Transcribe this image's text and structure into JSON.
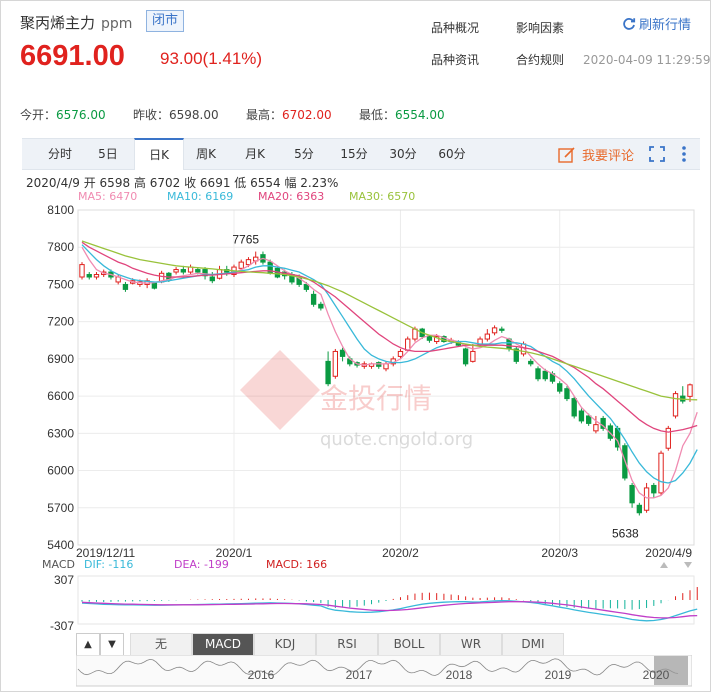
{
  "header": {
    "title": "聚丙烯主力",
    "unit": "ppm",
    "status": "闭市",
    "price": "6691.00",
    "change": "93.00(1.41%)",
    "links": [
      "品种概况",
      "影响因素",
      "品种资讯",
      "合约规则"
    ],
    "refresh": "刷新行情",
    "datetime": "2020-04-09 11:29:59"
  },
  "stats": [
    {
      "label": "今开：",
      "value": "6576.00",
      "color": "g"
    },
    {
      "label": "昨收：",
      "value": "6598.00",
      "color": ""
    },
    {
      "label": "最高：",
      "value": "6702.00",
      "color": "r"
    },
    {
      "label": "最低：",
      "value": "6554.00",
      "color": "g"
    }
  ],
  "tabs": [
    "分时",
    "5日",
    "日K",
    "周K",
    "月K",
    "5分",
    "15分",
    "30分",
    "60分"
  ],
  "active_tab": "日K",
  "comment": "我要评论",
  "bar_info": {
    "date": "2020/4/9",
    "open": "开 6598",
    "high": "高 6702",
    "close": "收 6691",
    "low": "低 6554",
    "amp": "幅 2.23%"
  },
  "ma_legend": [
    {
      "label": "MA5: 6470",
      "color": "#f08bb1"
    },
    {
      "label": "MA10: 6169",
      "color": "#39b9d9"
    },
    {
      "label": "MA20: 6363",
      "color": "#e0457d"
    },
    {
      "label": "MA30: 6570",
      "color": "#99c23b"
    }
  ],
  "macd_legend": [
    {
      "label": "MACD",
      "color": "#555555"
    },
    {
      "label": "DIF: -116",
      "color": "#39b9d9"
    },
    {
      "label": "DEA: -199",
      "color": "#c03ec8"
    },
    {
      "label": "MACD: 166",
      "color": "#d02020"
    }
  ],
  "macd_axis": {
    "top": "307",
    "bottom": "-307"
  },
  "indicator_tabs": [
    "无",
    "MACD",
    "KDJ",
    "RSI",
    "BOLL",
    "WR",
    "DMI"
  ],
  "active_indicator": "MACD",
  "nav_years": [
    "2016",
    "2017",
    "2018",
    "2019",
    "2020"
  ],
  "watermark": {
    "text": "金投行情",
    "url": "quote.cngold.org"
  },
  "chart_data": {
    "type": "candlestick",
    "y_ticks": [
      8100,
      7800,
      7500,
      7200,
      6900,
      6600,
      6300,
      6000,
      5700,
      5400
    ],
    "ylim": [
      5400,
      8100
    ],
    "x_labels": [
      "2019/12/11",
      "2020/1",
      "2020/2",
      "2020/3",
      "2020/4/9"
    ],
    "annotations": [
      {
        "label": "7765",
        "value": 7765
      },
      {
        "label": "5638",
        "value": 5638
      }
    ],
    "candles": [
      {
        "o": 7560,
        "c": 7660,
        "h": 7680,
        "l": 7540
      },
      {
        "o": 7580,
        "c": 7560,
        "h": 7600,
        "l": 7540
      },
      {
        "o": 7560,
        "c": 7580,
        "h": 7600,
        "l": 7540
      },
      {
        "o": 7580,
        "c": 7600,
        "h": 7620,
        "l": 7560
      },
      {
        "o": 7600,
        "c": 7560,
        "h": 7620,
        "l": 7540
      },
      {
        "o": 7520,
        "c": 7560,
        "h": 7580,
        "l": 7500
      },
      {
        "o": 7500,
        "c": 7460,
        "h": 7520,
        "l": 7440
      },
      {
        "o": 7510,
        "c": 7530,
        "h": 7550,
        "l": 7500
      },
      {
        "o": 7500,
        "c": 7520,
        "h": 7540,
        "l": 7480
      },
      {
        "o": 7500,
        "c": 7530,
        "h": 7550,
        "l": 7470
      },
      {
        "o": 7510,
        "c": 7470,
        "h": 7520,
        "l": 7460
      },
      {
        "o": 7520,
        "c": 7590,
        "h": 7610,
        "l": 7510
      },
      {
        "o": 7590,
        "c": 7540,
        "h": 7600,
        "l": 7520
      },
      {
        "o": 7600,
        "c": 7620,
        "h": 7640,
        "l": 7580
      },
      {
        "o": 7620,
        "c": 7600,
        "h": 7650,
        "l": 7580
      },
      {
        "o": 7600,
        "c": 7640,
        "h": 7660,
        "l": 7580
      },
      {
        "o": 7620,
        "c": 7600,
        "h": 7640,
        "l": 7580
      },
      {
        "o": 7620,
        "c": 7570,
        "h": 7640,
        "l": 7540
      },
      {
        "o": 7560,
        "c": 7530,
        "h": 7600,
        "l": 7510
      },
      {
        "o": 7550,
        "c": 7620,
        "h": 7650,
        "l": 7540
      },
      {
        "o": 7620,
        "c": 7600,
        "h": 7650,
        "l": 7570
      },
      {
        "o": 7580,
        "c": 7640,
        "h": 7660,
        "l": 7560
      },
      {
        "o": 7630,
        "c": 7680,
        "h": 7700,
        "l": 7620
      },
      {
        "o": 7660,
        "c": 7700,
        "h": 7720,
        "l": 7640
      },
      {
        "o": 7690,
        "c": 7720,
        "h": 7765,
        "l": 7660
      },
      {
        "o": 7740,
        "c": 7680,
        "h": 7765,
        "l": 7660
      },
      {
        "o": 7680,
        "c": 7590,
        "h": 7700,
        "l": 7580
      },
      {
        "o": 7630,
        "c": 7560,
        "h": 7640,
        "l": 7550
      },
      {
        "o": 7600,
        "c": 7570,
        "h": 7620,
        "l": 7540
      },
      {
        "o": 7580,
        "c": 7520,
        "h": 7600,
        "l": 7500
      },
      {
        "o": 7560,
        "c": 7500,
        "h": 7580,
        "l": 7480
      },
      {
        "o": 7500,
        "c": 7460,
        "h": 7520,
        "l": 7440
      },
      {
        "o": 7420,
        "c": 7340,
        "h": 7450,
        "l": 7320
      },
      {
        "o": 7340,
        "c": 7310,
        "h": 7360,
        "l": 7290
      },
      {
        "o": 6880,
        "c": 6700,
        "h": 6960,
        "l": 6680
      },
      {
        "o": 6760,
        "c": 6960,
        "h": 6980,
        "l": 6740
      },
      {
        "o": 6970,
        "c": 6920,
        "h": 6990,
        "l": 6880
      },
      {
        "o": 6900,
        "c": 6860,
        "h": 6920,
        "l": 6840
      },
      {
        "o": 6870,
        "c": 6850,
        "h": 6880,
        "l": 6830
      },
      {
        "o": 6840,
        "c": 6860,
        "h": 6880,
        "l": 6820
      },
      {
        "o": 6840,
        "c": 6860,
        "h": 6870,
        "l": 6820
      },
      {
        "o": 6870,
        "c": 6840,
        "h": 6880,
        "l": 6820
      },
      {
        "o": 6820,
        "c": 6860,
        "h": 6880,
        "l": 6800
      },
      {
        "o": 6860,
        "c": 6900,
        "h": 6920,
        "l": 6840
      },
      {
        "o": 6920,
        "c": 6960,
        "h": 6980,
        "l": 6900
      },
      {
        "o": 6970,
        "c": 7060,
        "h": 7080,
        "l": 6960
      },
      {
        "o": 7060,
        "c": 7140,
        "h": 7160,
        "l": 7040
      },
      {
        "o": 7140,
        "c": 7080,
        "h": 7150,
        "l": 7060
      },
      {
        "o": 7080,
        "c": 7050,
        "h": 7090,
        "l": 7030
      },
      {
        "o": 7040,
        "c": 7080,
        "h": 7100,
        "l": 7020
      },
      {
        "o": 7080,
        "c": 7040,
        "h": 7090,
        "l": 7030
      },
      {
        "o": 7040,
        "c": 7050,
        "h": 7070,
        "l": 7020
      },
      {
        "o": 7040,
        "c": 7010,
        "h": 7050,
        "l": 7000
      },
      {
        "o": 6980,
        "c": 6860,
        "h": 6990,
        "l": 6840
      },
      {
        "o": 6880,
        "c": 6960,
        "h": 7020,
        "l": 6870
      },
      {
        "o": 7020,
        "c": 7060,
        "h": 7080,
        "l": 7000
      },
      {
        "o": 7060,
        "c": 7100,
        "h": 7140,
        "l": 7040
      },
      {
        "o": 7110,
        "c": 7150,
        "h": 7170,
        "l": 7090
      },
      {
        "o": 7140,
        "c": 7130,
        "h": 7160,
        "l": 7110
      },
      {
        "o": 7060,
        "c": 6980,
        "h": 7070,
        "l": 6960
      },
      {
        "o": 6980,
        "c": 6880,
        "h": 7000,
        "l": 6860
      },
      {
        "o": 6940,
        "c": 7020,
        "h": 7040,
        "l": 6920
      },
      {
        "o": 6880,
        "c": 6860,
        "h": 6900,
        "l": 6840
      },
      {
        "o": 6820,
        "c": 6740,
        "h": 6840,
        "l": 6720
      },
      {
        "o": 6800,
        "c": 6740,
        "h": 6820,
        "l": 6720
      },
      {
        "o": 6780,
        "c": 6720,
        "h": 6800,
        "l": 6700
      },
      {
        "o": 6700,
        "c": 6640,
        "h": 6720,
        "l": 6620
      },
      {
        "o": 6660,
        "c": 6580,
        "h": 6680,
        "l": 6560
      },
      {
        "o": 6580,
        "c": 6440,
        "h": 6600,
        "l": 6420
      },
      {
        "o": 6480,
        "c": 6400,
        "h": 6500,
        "l": 6380
      },
      {
        "o": 6440,
        "c": 6380,
        "h": 6460,
        "l": 6360
      },
      {
        "o": 6320,
        "c": 6370,
        "h": 6440,
        "l": 6300
      },
      {
        "o": 6420,
        "c": 6340,
        "h": 6440,
        "l": 6320
      },
      {
        "o": 6360,
        "c": 6260,
        "h": 6380,
        "l": 6240
      },
      {
        "o": 6340,
        "c": 6190,
        "h": 6360,
        "l": 6160
      },
      {
        "o": 6200,
        "c": 5940,
        "h": 6220,
        "l": 5920
      },
      {
        "o": 5880,
        "c": 5740,
        "h": 5900,
        "l": 5700
      },
      {
        "o": 5720,
        "c": 5660,
        "h": 5740,
        "l": 5638
      },
      {
        "o": 5680,
        "c": 5860,
        "h": 5900,
        "l": 5660
      },
      {
        "o": 5880,
        "c": 5820,
        "h": 5900,
        "l": 5780
      },
      {
        "o": 5820,
        "c": 6140,
        "h": 6160,
        "l": 5800
      },
      {
        "o": 6180,
        "c": 6340,
        "h": 6360,
        "l": 6160
      },
      {
        "o": 6440,
        "c": 6620,
        "h": 6640,
        "l": 6420
      },
      {
        "o": 6600,
        "c": 6560,
        "h": 6680,
        "l": 6540
      },
      {
        "o": 6598,
        "c": 6691,
        "h": 6702,
        "l": 6554
      }
    ],
    "ma5": [
      7800,
      7700,
      7620,
      7590,
      7580,
      7560,
      7540,
      7520,
      7515,
      7510,
      7515,
      7530,
      7540,
      7560,
      7570,
      7580,
      7590,
      7585,
      7580,
      7585,
      7590,
      7595,
      7620,
      7650,
      7690,
      7710,
      7690,
      7650,
      7610,
      7580,
      7550,
      7510,
      7460,
      7420,
      7260,
      7120,
      7000,
      6900,
      6860,
      6850,
      6860,
      6860,
      6860,
      6870,
      6900,
      6960,
      7030,
      7070,
      7090,
      7090,
      7070,
      7050,
      7040,
      7000,
      6980,
      6990,
      7010,
      7050,
      7080,
      7060,
      7020,
      6990,
      6920,
      6860,
      6810,
      6780,
      6740,
      6690,
      6600,
      6510,
      6450,
      6400,
      6360,
      6300,
      6240,
      6080,
      5920,
      5820,
      5780,
      5780,
      5800,
      5860,
      6000,
      6200,
      6300,
      6470
    ],
    "ma10": [
      7820,
      7760,
      7700,
      7650,
      7610,
      7580,
      7560,
      7540,
      7530,
      7525,
      7520,
      7520,
      7530,
      7540,
      7550,
      7560,
      7570,
      7580,
      7580,
      7585,
      7590,
      7600,
      7610,
      7620,
      7640,
      7650,
      7650,
      7640,
      7630,
      7615,
      7600,
      7570,
      7540,
      7500,
      7420,
      7330,
      7240,
      7150,
      7060,
      6980,
      6930,
      6900,
      6880,
      6870,
      6870,
      6880,
      6900,
      6930,
      6960,
      6990,
      7010,
      7030,
      7040,
      7040,
      7030,
      7020,
      7020,
      7020,
      7030,
      7030,
      7030,
      7020,
      7000,
      6960,
      6920,
      6880,
      6850,
      6800,
      6740,
      6670,
      6600,
      6540,
      6480,
      6420,
      6340,
      6250,
      6150,
      6060,
      5990,
      5940,
      5910,
      5900,
      5920,
      5980,
      6060,
      6169
    ],
    "ma20": [
      7840,
      7800,
      7770,
      7740,
      7710,
      7680,
      7660,
      7630,
      7610,
      7590,
      7575,
      7565,
      7560,
      7560,
      7560,
      7565,
      7570,
      7575,
      7575,
      7580,
      7585,
      7590,
      7595,
      7600,
      7605,
      7610,
      7610,
      7600,
      7590,
      7580,
      7570,
      7550,
      7520,
      7480,
      7440,
      7400,
      7350,
      7300,
      7250,
      7200,
      7150,
      7100,
      7060,
      7020,
      6990,
      6970,
      6960,
      6960,
      6960,
      6970,
      6980,
      6990,
      7000,
      7010,
      7010,
      7010,
      7010,
      7010,
      7010,
      7005,
      7000,
      6990,
      6980,
      6960,
      6940,
      6920,
      6890,
      6860,
      6830,
      6790,
      6750,
      6700,
      6660,
      6610,
      6560,
      6510,
      6460,
      6410,
      6370,
      6340,
      6320,
      6310,
      6320,
      6330,
      6345,
      6363
    ],
    "ma30": [
      7850,
      7830,
      7810,
      7790,
      7770,
      7750,
      7730,
      7715,
      7700,
      7690,
      7680,
      7670,
      7660,
      7650,
      7645,
      7640,
      7635,
      7630,
      7625,
      7620,
      7615,
      7610,
      7605,
      7600,
      7598,
      7595,
      7590,
      7585,
      7580,
      7570,
      7560,
      7545,
      7530,
      7510,
      7490,
      7465,
      7440,
      7410,
      7380,
      7350,
      7320,
      7290,
      7260,
      7230,
      7200,
      7170,
      7140,
      7110,
      7090,
      7070,
      7050,
      7040,
      7030,
      7020,
      7010,
      7000,
      6995,
      6990,
      6985,
      6980,
      6970,
      6960,
      6950,
      6935,
      6920,
      6900,
      6880,
      6860,
      6840,
      6820,
      6800,
      6780,
      6760,
      6740,
      6720,
      6700,
      6680,
      6660,
      6640,
      6620,
      6600,
      6590,
      6580,
      6575,
      6572,
      6570
    ],
    "macd": {
      "ylim": [
        -307,
        307
      ],
      "dif": [
        -40,
        -45,
        -50,
        -55,
        -58,
        -60,
        -62,
        -63,
        -64,
        -65,
        -66,
        -66,
        -65,
        -64,
        -62,
        -60,
        -58,
        -56,
        -54,
        -52,
        -50,
        -48,
        -46,
        -44,
        -40,
        -38,
        -36,
        -38,
        -40,
        -44,
        -50,
        -58,
        -66,
        -76,
        -110,
        -130,
        -140,
        -150,
        -155,
        -158,
        -156,
        -150,
        -140,
        -126,
        -110,
        -90,
        -70,
        -54,
        -42,
        -34,
        -28,
        -24,
        -20,
        -22,
        -26,
        -24,
        -18,
        -12,
        -8,
        -10,
        -16,
        -24,
        -32,
        -44,
        -60,
        -76,
        -92,
        -108,
        -126,
        -142,
        -158,
        -172,
        -186,
        -198,
        -212,
        -230,
        -250,
        -260,
        -266,
        -262,
        -250,
        -230,
        -200,
        -170,
        -140,
        -116
      ],
      "dea": [
        -30,
        -34,
        -38,
        -42,
        -46,
        -50,
        -52,
        -54,
        -56,
        -58,
        -60,
        -61,
        -62,
        -62,
        -62,
        -62,
        -61,
        -60,
        -59,
        -58,
        -56,
        -55,
        -54,
        -52,
        -50,
        -48,
        -46,
        -45,
        -45,
        -46,
        -47,
        -49,
        -53,
        -57,
        -67,
        -79,
        -91,
        -103,
        -113,
        -122,
        -129,
        -133,
        -134,
        -133,
        -128,
        -121,
        -111,
        -100,
        -89,
        -78,
        -68,
        -59,
        -51,
        -45,
        -41,
        -37,
        -33,
        -29,
        -25,
        -22,
        -21,
        -22,
        -24,
        -28,
        -34,
        -42,
        -52,
        -63,
        -76,
        -89,
        -103,
        -117,
        -131,
        -145,
        -158,
        -172,
        -188,
        -202,
        -215,
        -224,
        -229,
        -229,
        -224,
        -214,
        -202,
        -199
      ],
      "hist": [
        -20,
        -22,
        -24,
        -26,
        -24,
        -20,
        -20,
        -18,
        -16,
        -14,
        -12,
        -10,
        -6,
        -4,
        0,
        4,
        6,
        8,
        10,
        12,
        12,
        14,
        16,
        16,
        20,
        20,
        20,
        14,
        10,
        4,
        -6,
        -18,
        -26,
        -38,
        -86,
        -102,
        -98,
        -94,
        -84,
        -72,
        -54,
        -34,
        -12,
        14,
        36,
        62,
        82,
        92,
        94,
        88,
        80,
        70,
        62,
        46,
        30,
        26,
        30,
        34,
        34,
        24,
        10,
        -4,
        -16,
        -32,
        -52,
        -68,
        -80,
        -90,
        -100,
        -106,
        -110,
        -110,
        -110,
        -106,
        -108,
        -116,
        -124,
        -116,
        -102,
        -76,
        -42,
        -2,
        48,
        88,
        124,
        166
      ]
    }
  }
}
